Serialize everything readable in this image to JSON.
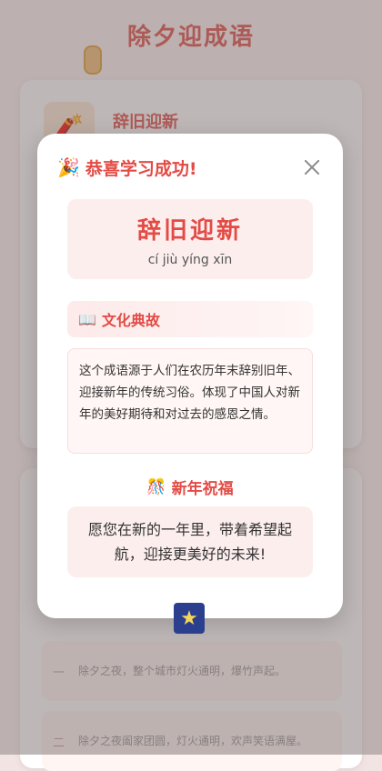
{
  "background": {
    "page_title": "除夕迎成语",
    "card_title": "辞旧迎新",
    "card_icon": "firecracker-icon",
    "rows": [
      {
        "num": "一",
        "text": "除夕之夜，整个城市灯火通明，爆竹声起。"
      },
      {
        "num": "二",
        "text": "除夕之夜阖家团圆，灯火通明，欢声笑语满屋。"
      }
    ]
  },
  "modal": {
    "title_icon": "🎉",
    "title": "恭喜学习成功!",
    "close_icon": "close-icon",
    "idiom": {
      "word": "辞旧迎新",
      "pinyin": "cí jiù yíng xīn"
    },
    "culture": {
      "icon": "📖",
      "label": "文化典故",
      "text": "这个成语源于人们在农历年末辞别旧年、迎接新年的传统习俗。体现了中国人对新年的美好期待和对过去的感恩之情。"
    },
    "blessing": {
      "icon": "🎊",
      "label": "新年祝福",
      "text": "愿您在新的一年里，带着希望起航，迎接更美好的未来!"
    }
  },
  "colors": {
    "accent": "#e34b45",
    "soft_pink": "#fdeeee"
  }
}
